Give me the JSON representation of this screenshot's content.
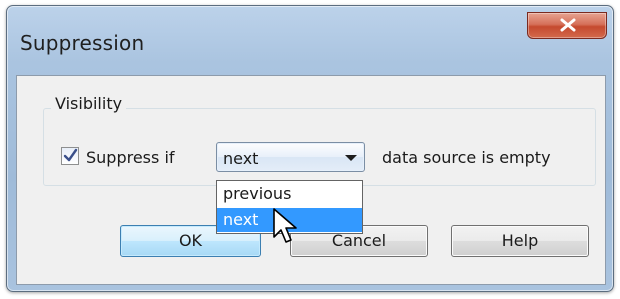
{
  "window": {
    "title": "Suppression"
  },
  "visibility_group": {
    "label": "Visibility",
    "checkbox_label": "Suppress if",
    "checkbox_checked": true,
    "combo_selected": "next",
    "after_text": "data source is empty",
    "dropdown_options": [
      "previous",
      "next"
    ],
    "highlighted_option": "next"
  },
  "buttons": {
    "ok": "OK",
    "cancel": "Cancel",
    "help": "Help"
  },
  "icons": {
    "close": "close-icon",
    "check": "check-icon",
    "dropdown": "chevron-down-icon",
    "cursor": "mouse-pointer-icon"
  },
  "colors": {
    "highlight": "#3399ff",
    "close_button": "#c54a2f",
    "titlebar": "#aac4e0"
  }
}
